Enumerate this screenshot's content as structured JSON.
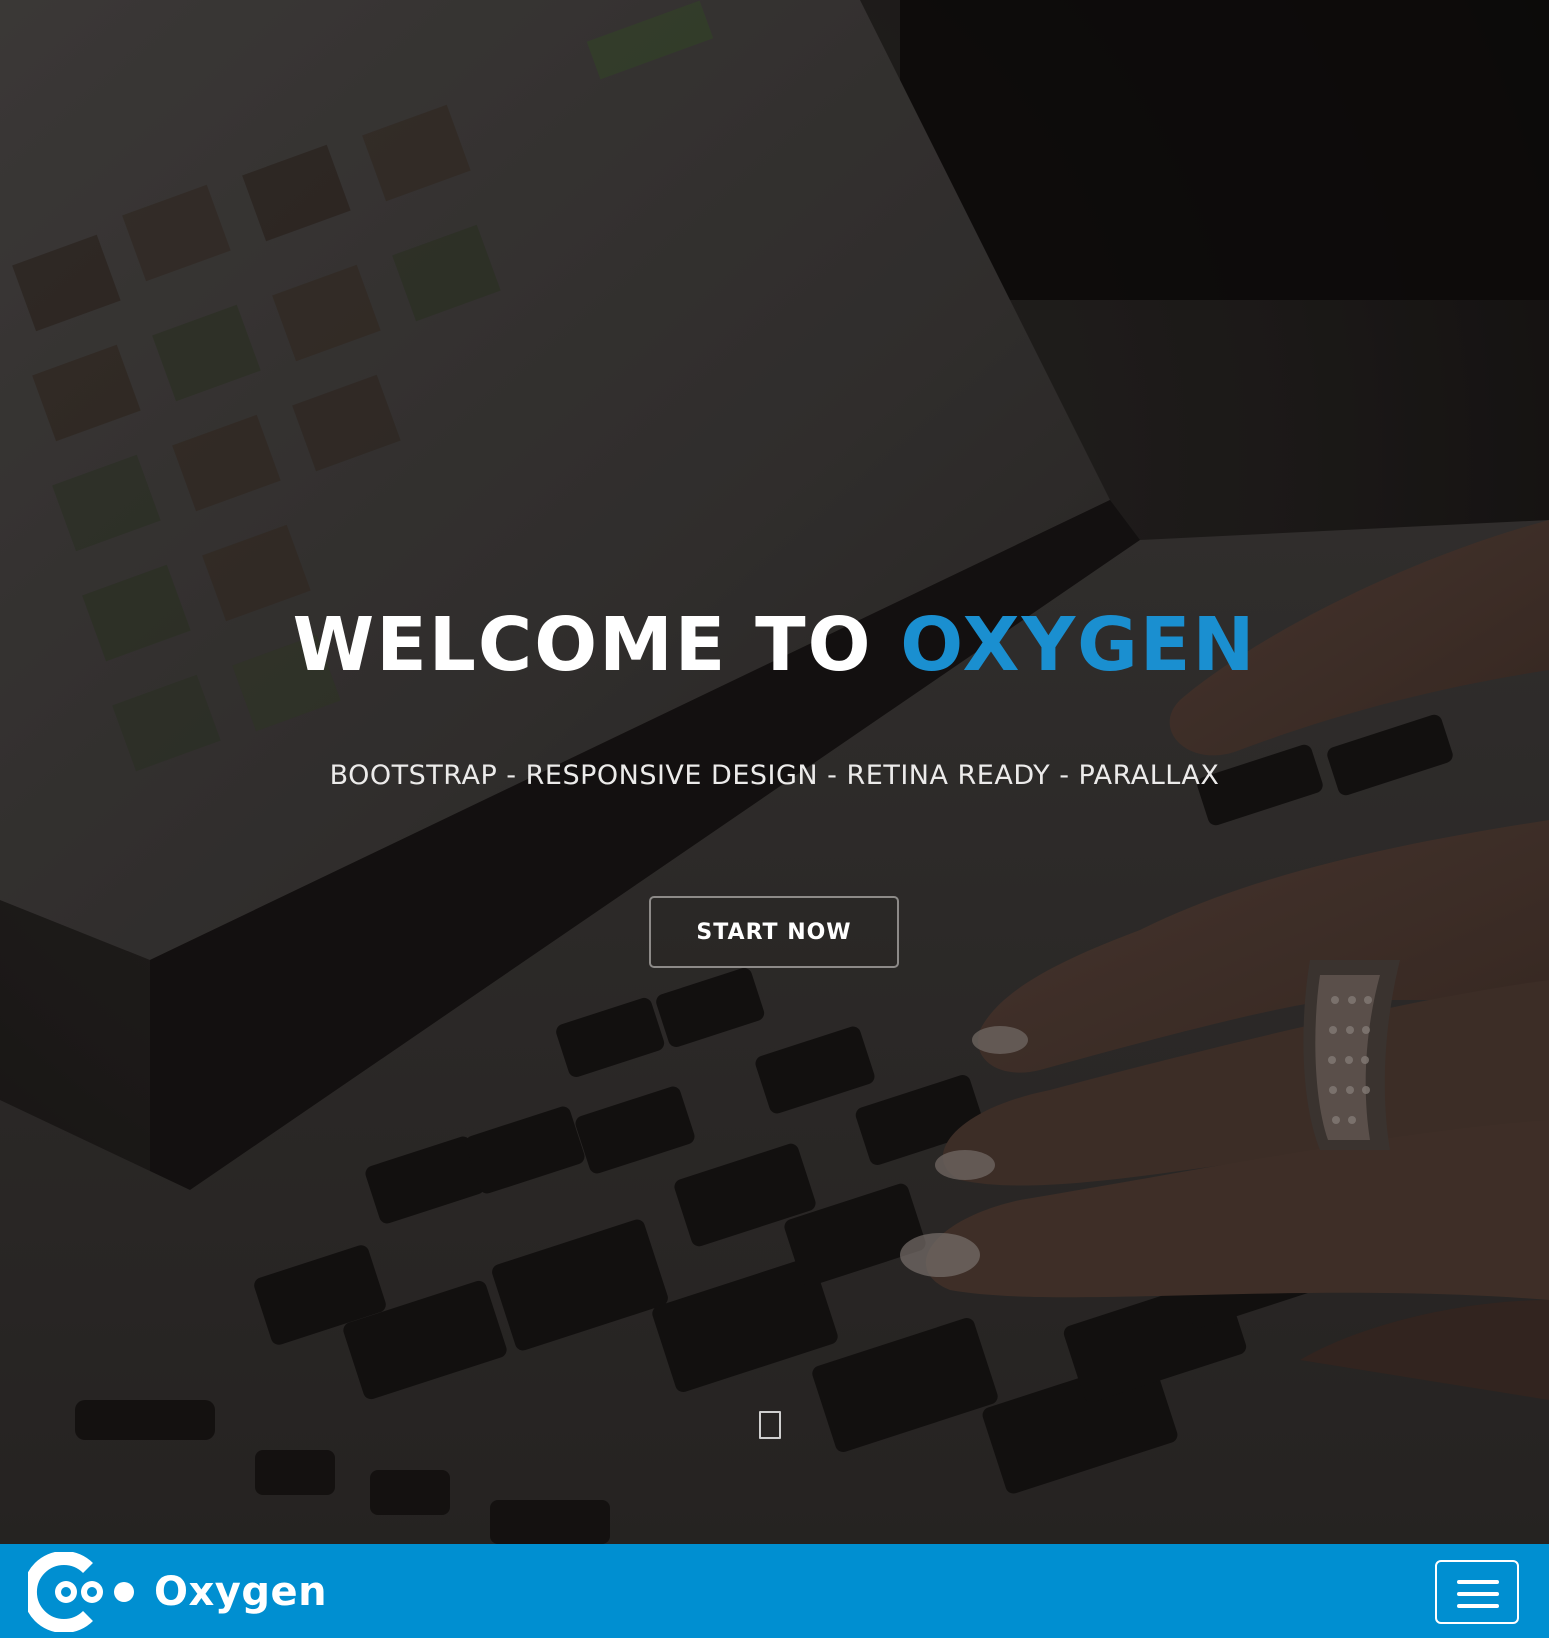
{
  "hero": {
    "title_main": "WELCOME TO ",
    "title_accent": "OXYGEN",
    "subtitle": "BOOTSTRAP - RESPONSIVE DESIGN - RETINA READY - PARALLAX",
    "cta_label": "START NOW",
    "background_image": "laptop-typing-photo",
    "scroll_indicator_icon": "mouse-scroll-icon"
  },
  "navbar": {
    "brand_name": "Oxygen",
    "logo_icon": "oxygen-logo-icon",
    "menu_icon": "hamburger-menu-icon"
  },
  "colors": {
    "accent": "#1a8fd0",
    "navbar_bg": "#008fd1",
    "text_light": "#ffffff"
  }
}
